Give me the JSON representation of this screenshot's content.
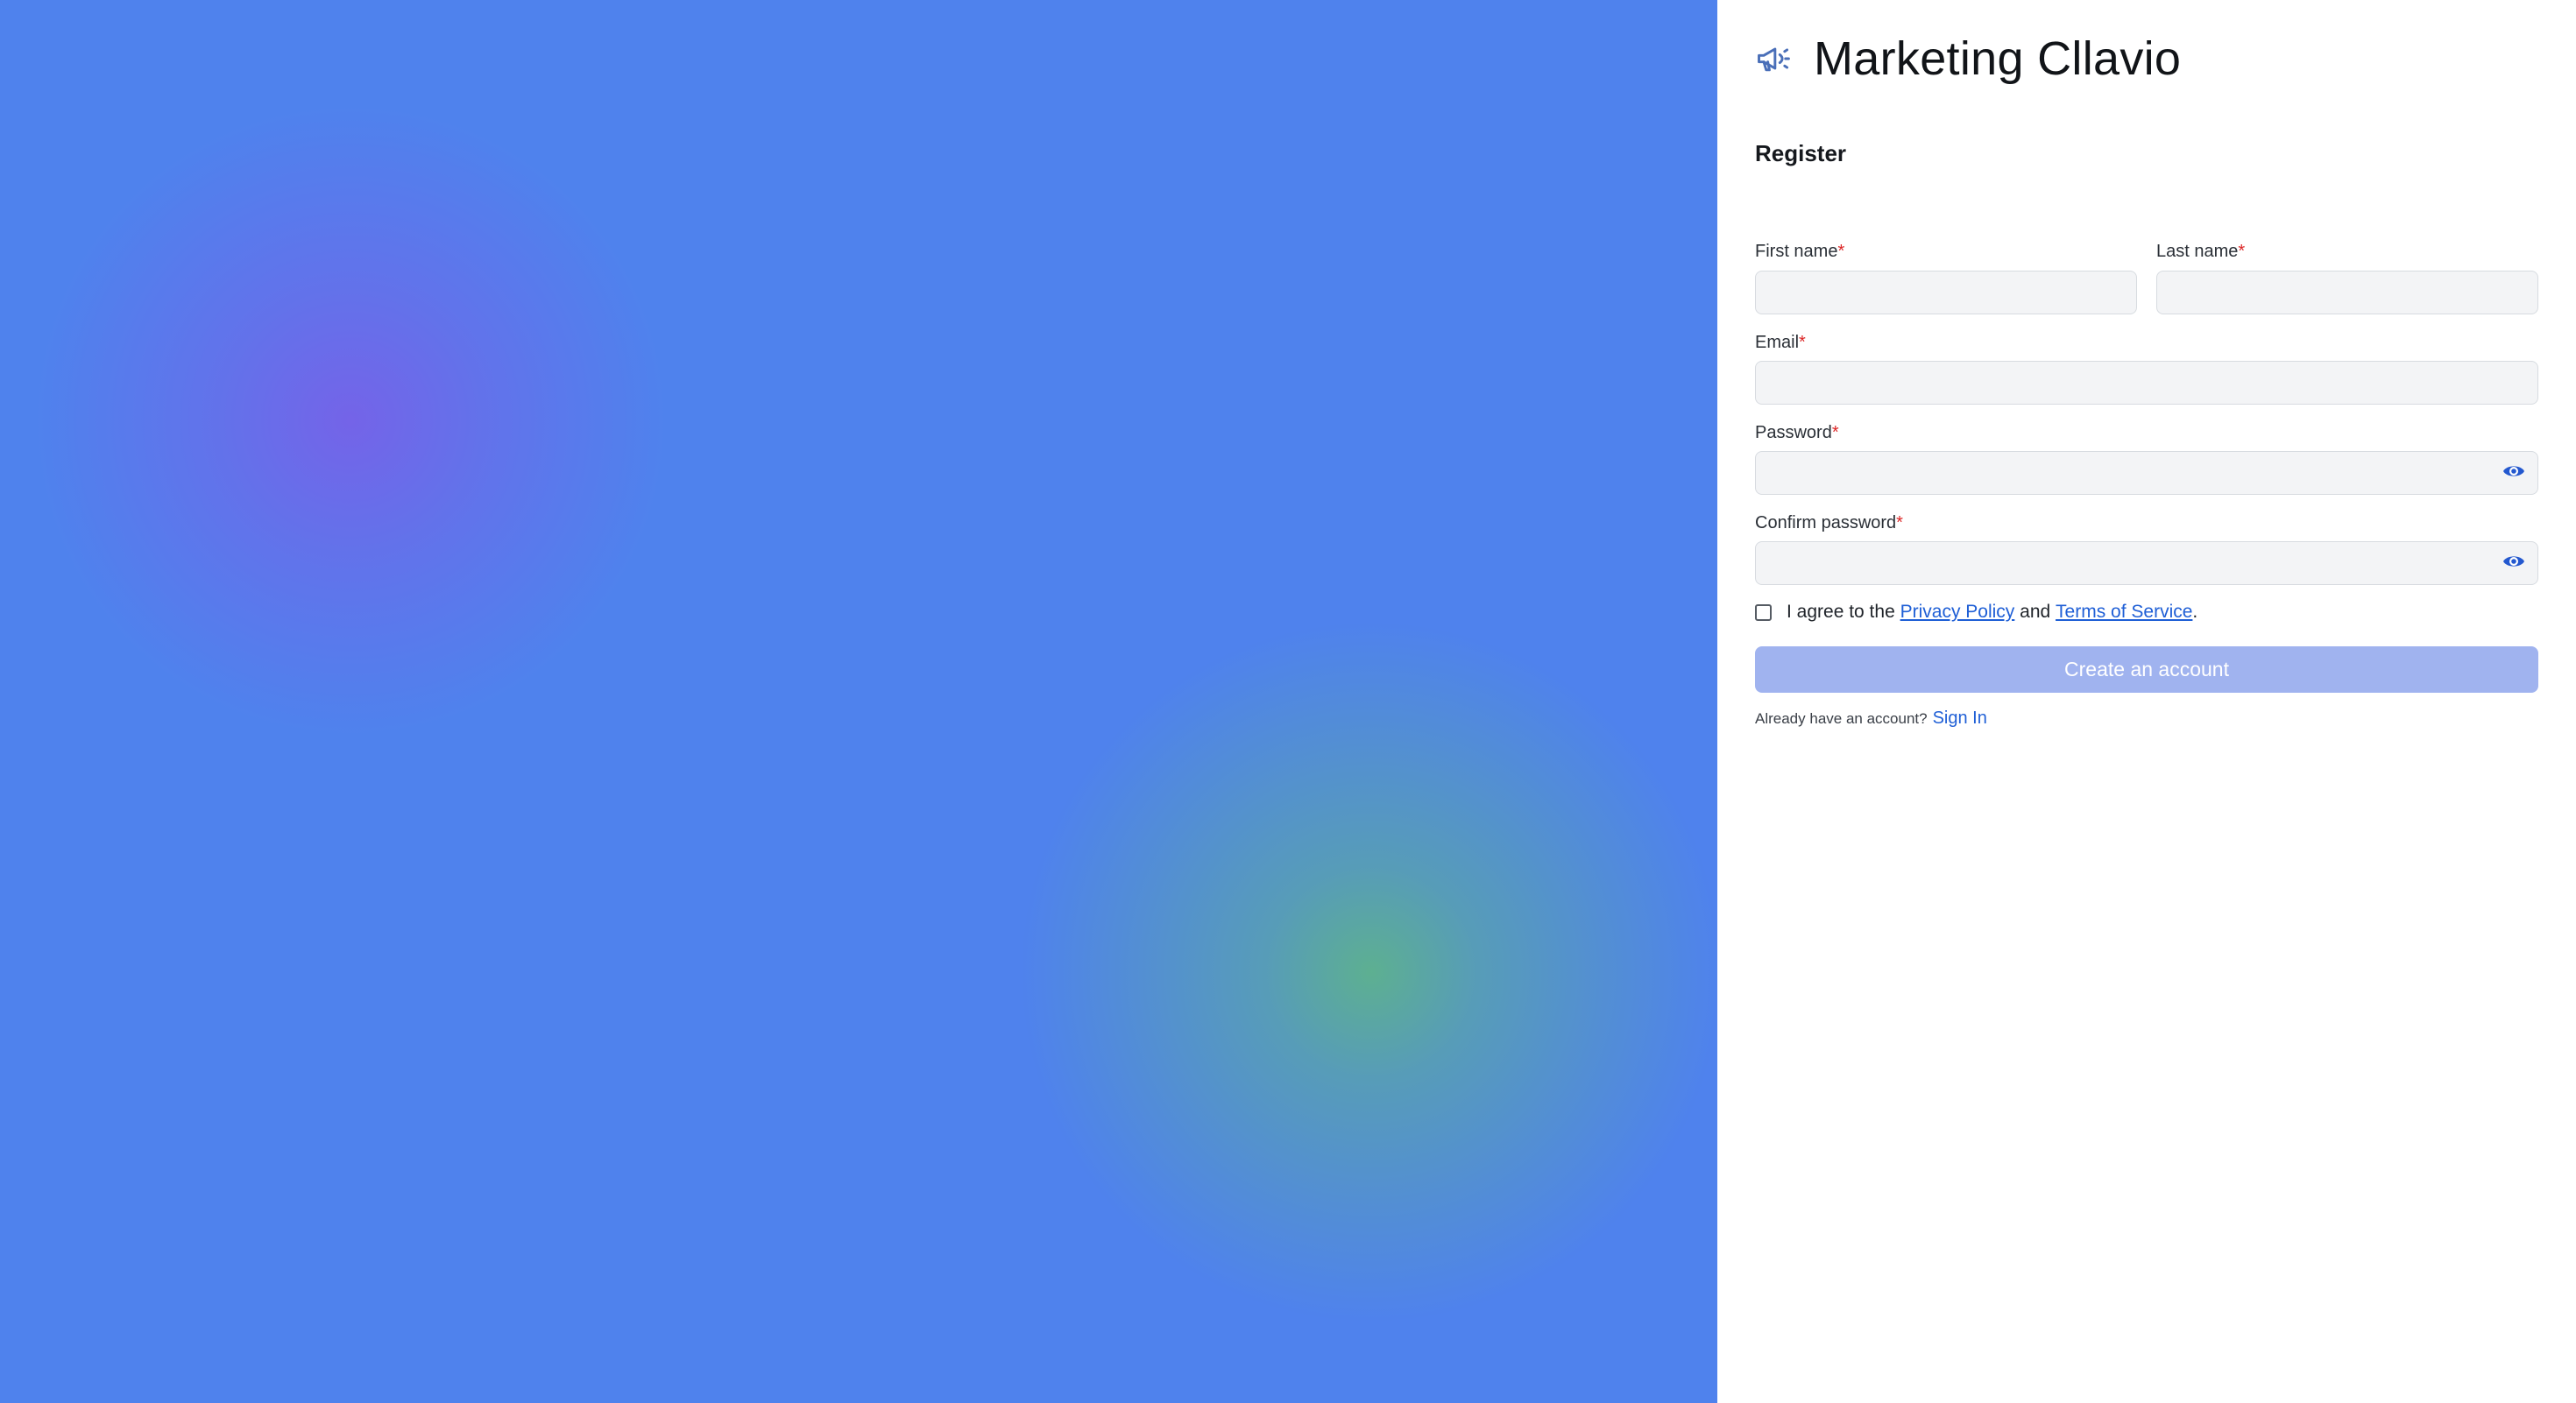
{
  "brand": {
    "title": "Marketing Cllavio",
    "icon": "megaphone-icon"
  },
  "form": {
    "heading": "Register",
    "required_mark": "*",
    "first_name": {
      "label": "First name",
      "value": "",
      "placeholder": ""
    },
    "last_name": {
      "label": "Last name",
      "value": "",
      "placeholder": ""
    },
    "email": {
      "label": "Email",
      "value": "",
      "placeholder": ""
    },
    "password": {
      "label": "Password",
      "value": "",
      "placeholder": "",
      "toggle_icon": "eye-icon"
    },
    "confirm_password": {
      "label": "Confirm password",
      "value": "",
      "placeholder": "",
      "toggle_icon": "eye-icon"
    },
    "agree": {
      "checked": false,
      "prefix": "I agree to the",
      "privacy_link": "Privacy Policy",
      "conjunction": "and",
      "terms_link": "Terms of Service",
      "suffix": "."
    },
    "submit_label": "Create an account",
    "submit_disabled": true,
    "signin_prompt": "Already have an account?",
    "signin_link": "Sign In"
  },
  "colors": {
    "hero_background": "#4f82ed",
    "hero_glow_purple": "#7662e8",
    "hero_glow_green": "#5eb28c",
    "accent": "#1f5fd6",
    "button_disabled": "#a0b3ef",
    "required": "#dc2626"
  }
}
